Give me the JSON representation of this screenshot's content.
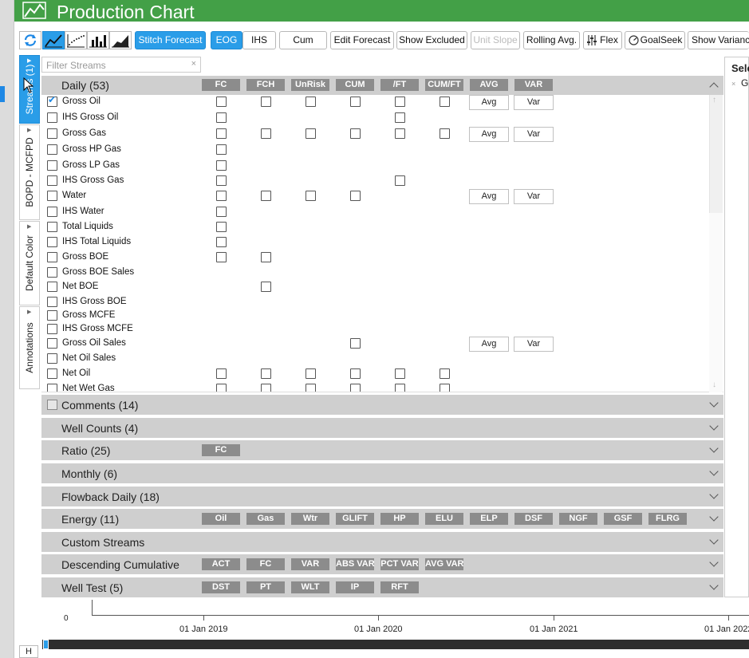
{
  "window": {
    "title": "Production Chart"
  },
  "toolbar": {
    "buttons": [
      {
        "label": "Stitch Forecast"
      },
      {
        "label": "EOG"
      },
      {
        "label": "IHS"
      },
      {
        "label": "Cum"
      },
      {
        "label": "Edit Forecast"
      },
      {
        "label": "Show Excluded"
      },
      {
        "label": "Unit Slope"
      },
      {
        "label": "Rolling Avg."
      },
      {
        "label": "Flex"
      },
      {
        "label": "GoalSeek"
      },
      {
        "label": "Show Varianc"
      }
    ]
  },
  "side_tabs": [
    {
      "label": "Streams (1)"
    },
    {
      "label": "BOPD - MCFPD"
    },
    {
      "label": "Default Color"
    },
    {
      "label": "Annotations"
    }
  ],
  "filter": {
    "placeholder": "Filter Streams",
    "clear": "×"
  },
  "daily": {
    "label": "Daily (53)",
    "columns": [
      "FC",
      "FCH",
      "UnRisk",
      "CUM",
      "/FT",
      "CUM/FT",
      "AVG",
      "VAR"
    ],
    "rows": [
      {
        "name": "Gross Oil",
        "checked": true,
        "cols": [
          1,
          1,
          1,
          1,
          1,
          1
        ],
        "avg": "Avg",
        "var": "Var"
      },
      {
        "name": "IHS Gross Oil",
        "checked": false,
        "cols": [
          1,
          0,
          0,
          0,
          1,
          0
        ]
      },
      {
        "name": "Gross Gas",
        "checked": false,
        "cols": [
          1,
          1,
          1,
          1,
          1,
          1
        ],
        "avg": "Avg",
        "var": "Var"
      },
      {
        "name": "Gross HP Gas",
        "checked": false,
        "cols": [
          1,
          0,
          0,
          0,
          0,
          0
        ]
      },
      {
        "name": "Gross LP Gas",
        "checked": false,
        "cols": [
          1,
          0,
          0,
          0,
          0,
          0
        ]
      },
      {
        "name": "IHS Gross Gas",
        "checked": false,
        "cols": [
          1,
          0,
          0,
          0,
          1,
          0
        ]
      },
      {
        "name": "Water",
        "checked": false,
        "cols": [
          1,
          1,
          1,
          1,
          0,
          0
        ],
        "avg": "Avg",
        "var": "Var"
      },
      {
        "name": "IHS Water",
        "checked": false,
        "cols": [
          1,
          0,
          0,
          0,
          0,
          0
        ]
      },
      {
        "name": "Total Liquids",
        "checked": false,
        "cols": [
          1,
          0,
          0,
          0,
          0,
          0
        ]
      },
      {
        "name": "IHS Total Liquids",
        "checked": false,
        "cols": [
          1,
          0,
          0,
          0,
          0,
          0
        ]
      },
      {
        "name": "Gross BOE",
        "checked": false,
        "cols": [
          1,
          1,
          0,
          0,
          0,
          0
        ]
      },
      {
        "name": "Gross BOE Sales",
        "checked": false,
        "cols": [
          0,
          0,
          0,
          0,
          0,
          0
        ]
      },
      {
        "name": "Net BOE",
        "checked": false,
        "cols": [
          0,
          1,
          0,
          0,
          0,
          0
        ]
      },
      {
        "name": "IHS Gross BOE",
        "checked": false,
        "cols": [
          0,
          0,
          0,
          0,
          0,
          0
        ]
      },
      {
        "name": "Gross MCFE",
        "checked": false,
        "cols": [
          0,
          0,
          0,
          0,
          0,
          0
        ]
      },
      {
        "name": "IHS Gross MCFE",
        "checked": false,
        "cols": [
          0,
          0,
          0,
          0,
          0,
          0
        ]
      },
      {
        "name": "Gross Oil Sales",
        "checked": false,
        "cols": [
          0,
          0,
          0,
          1,
          0,
          0
        ],
        "avg": "Avg",
        "var": "Var"
      },
      {
        "name": "Net Oil Sales",
        "checked": false,
        "cols": [
          0,
          0,
          0,
          0,
          0,
          0
        ]
      },
      {
        "name": "Net Oil",
        "checked": false,
        "cols": [
          1,
          1,
          1,
          1,
          1,
          1
        ]
      },
      {
        "name": "Net Wet Gas",
        "checked": false,
        "cols": [
          1,
          1,
          1,
          1,
          1,
          1
        ]
      }
    ]
  },
  "groups": [
    {
      "label": "Comments (14)",
      "checkbox": true,
      "pills": []
    },
    {
      "label": "Well Counts (4)",
      "pills": []
    },
    {
      "label": "Ratio (25)",
      "pills": [
        "FC"
      ]
    },
    {
      "label": "Monthly (6)",
      "pills": []
    },
    {
      "label": "Flowback Daily (18)",
      "pills": []
    },
    {
      "label": "Energy (11)",
      "pills": [
        "Oil",
        "Gas",
        "Wtr",
        "GLIFT",
        "HP",
        "ELU",
        "ELP",
        "DSF",
        "NGF",
        "GSF",
        "FLRG"
      ]
    },
    {
      "label": "Custom Streams",
      "pills": []
    },
    {
      "label": "Descending Cumulative",
      "pills": [
        "ACT",
        "FC",
        "VAR",
        "ABS VAR",
        "PCT VAR",
        "AVG VAR"
      ]
    },
    {
      "label": "Well Test (5)",
      "pills": [
        "DST",
        "PT",
        "WLT",
        "IP",
        "RFT"
      ]
    }
  ],
  "right_panel": {
    "title": "Sele",
    "item": "G",
    "x": "×"
  },
  "axis": {
    "y_label": "0",
    "ticks": [
      "01 Jan 2019",
      "01 Jan 2020",
      "01 Jan 2021",
      "01 Jan 2022"
    ]
  },
  "bottom": {
    "h_label": "H"
  },
  "colors": {
    "accent": "#2a9de8",
    "titlebar": "#43a047",
    "group": "#cfcfcf",
    "pill": "#8c8c8c"
  }
}
